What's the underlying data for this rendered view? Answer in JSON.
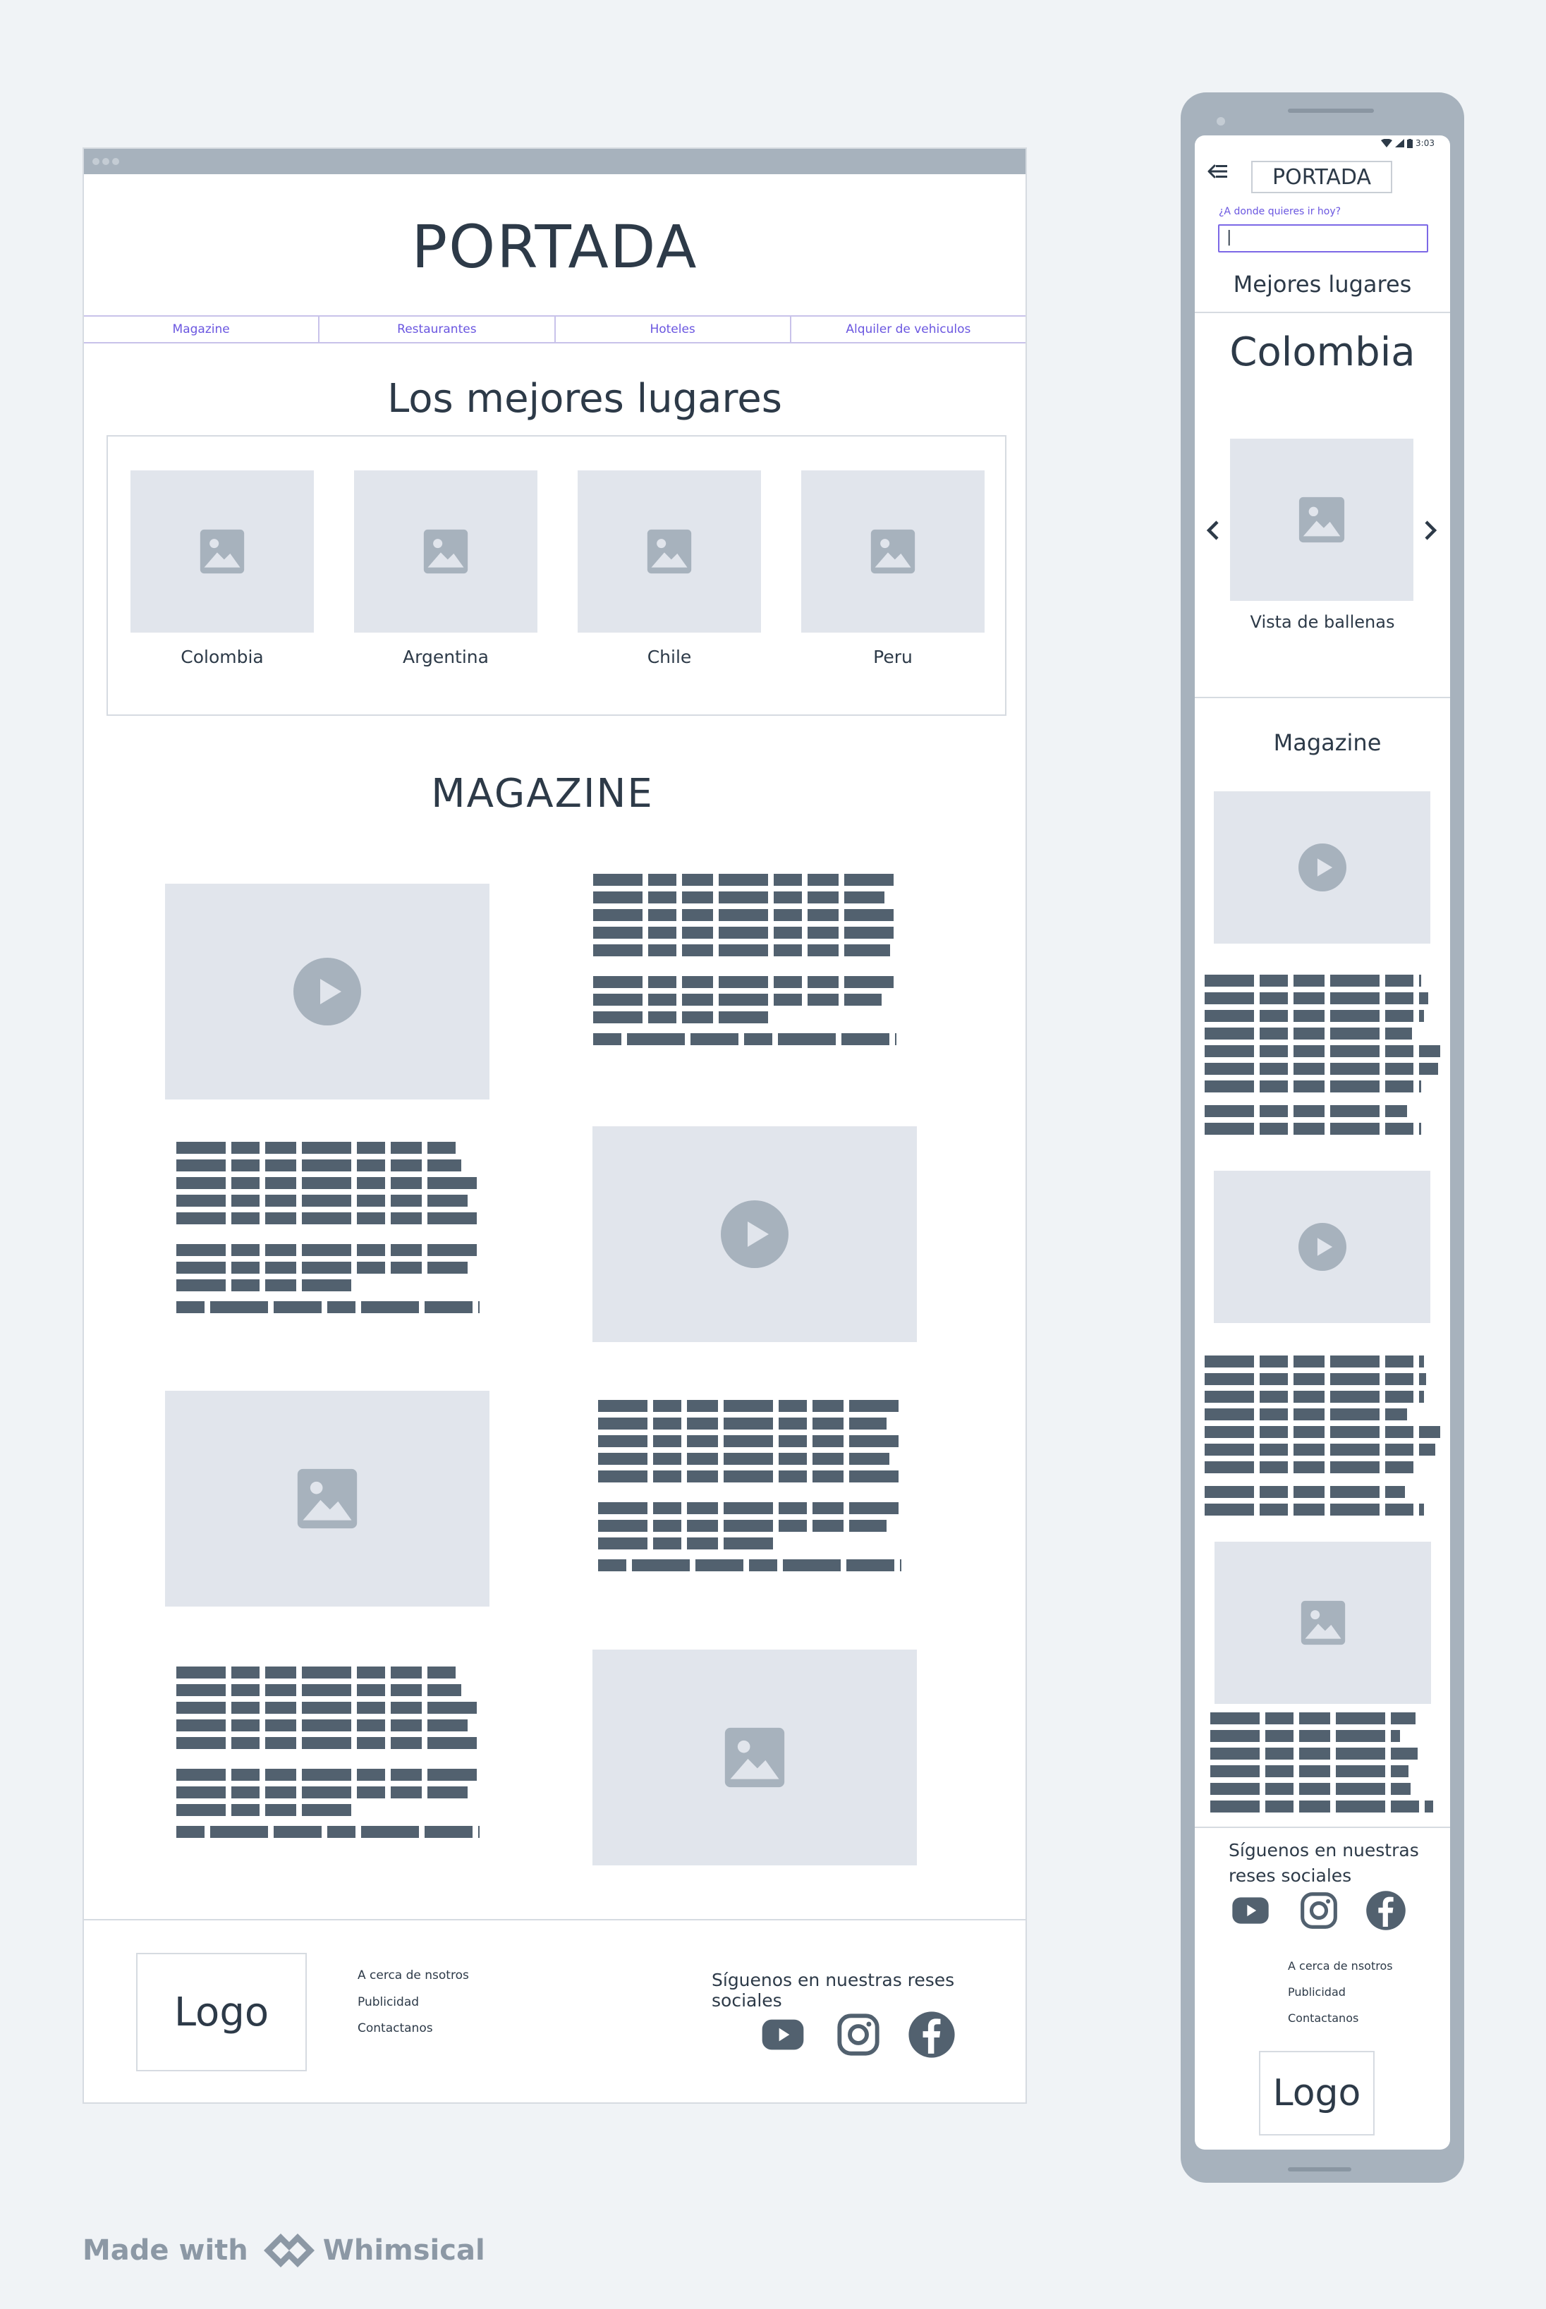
{
  "desktop": {
    "title": "PORTADA",
    "nav": [
      "Magazine",
      "Restaurantes",
      "Hoteles",
      "Alquiler de vehiculos"
    ],
    "places_title": "Los mejores lugares",
    "places": [
      "Colombia",
      "Argentina",
      "Chile",
      "Peru"
    ],
    "magazine_title": "MAGAZINE",
    "footer": {
      "logo": "Logo",
      "links": [
        "A cerca de nsotros",
        "Publicidad",
        "Contactanos"
      ],
      "social_text": "Síguenos en nuestras reses sociales",
      "social_icons": [
        "youtube-icon",
        "instagram-icon",
        "facebook-icon"
      ]
    }
  },
  "mobile": {
    "status_time": "3:03",
    "title": "PORTADA",
    "search_label": "¿A donde quieres ir hoy?",
    "search_value": "|",
    "best_places": "Mejores lugares",
    "country": "Colombia",
    "carousel_caption": "Vista de ballenas",
    "magazine_title": "Magazine",
    "social_text": "Síguenos en nuestras reses sociales",
    "links": [
      "A cerca de nsotros",
      "Publicidad",
      "Contactanos"
    ],
    "logo": "Logo"
  },
  "watermark": {
    "made_with": "Made with",
    "brand": "Whimsical"
  },
  "colors": {
    "background": "#f0f3f6",
    "placeholder": "#e1e5ec",
    "icon": "#a7b2bd",
    "text_block": "#52616f",
    "accent": "#6a56e0"
  }
}
